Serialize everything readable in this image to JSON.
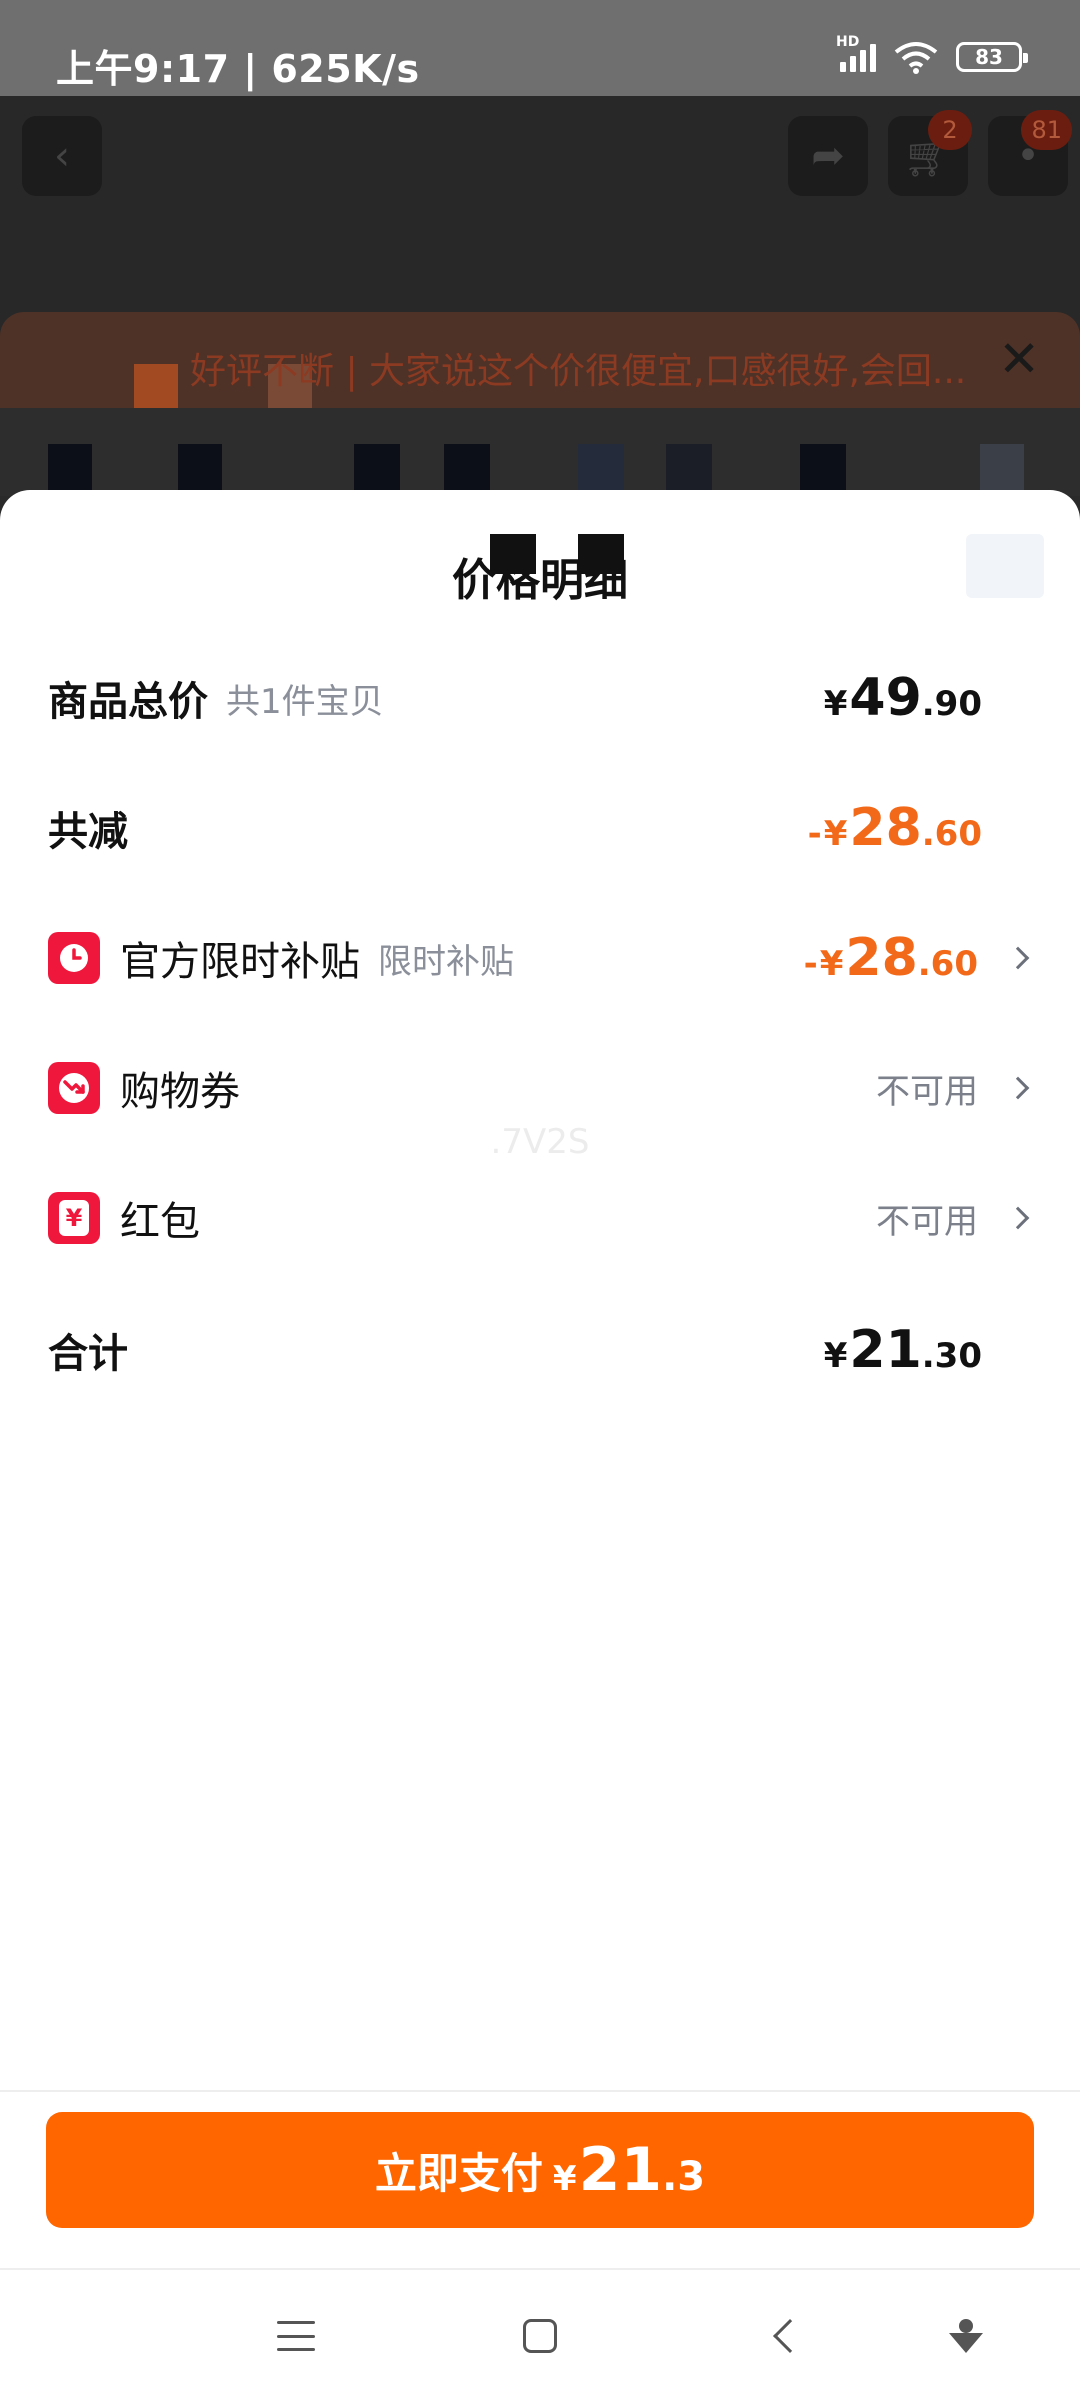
{
  "status_bar": {
    "time": "上午9:17 | 625K/s",
    "battery": "83",
    "network_label": "HD"
  },
  "background_page": {
    "cart_badge": "2",
    "more_badge": "81",
    "notice_text": "好评不断 | 大家说这个价很便宜,口感很好,会回..."
  },
  "sheet": {
    "title": "价格明细",
    "watermark": ".7V2S",
    "rows": {
      "total_goods": {
        "label": "商品总价",
        "sub": "共1件宝贝",
        "currency": "¥",
        "integer": "49",
        "decimal": ".90"
      },
      "total_discount": {
        "label": "共减",
        "prefix": "-",
        "currency": "¥",
        "integer": "28",
        "decimal": ".60"
      },
      "official_subsidy": {
        "label": "官方限时补贴",
        "sub": "限时补贴",
        "prefix": "-",
        "currency": "¥",
        "integer": "28",
        "decimal": ".60",
        "icon": "clock-icon"
      },
      "coupon": {
        "label": "购物券",
        "status": "不可用",
        "icon": "coupon-arrow-icon"
      },
      "red_packet": {
        "label": "红包",
        "status": "不可用",
        "icon": "yen-icon",
        "icon_glyph": "¥"
      },
      "subtotal": {
        "label": "合计",
        "currency": "¥",
        "integer": "21",
        "decimal": ".30"
      }
    }
  },
  "pay_button": {
    "label": "立即支付",
    "currency": "¥",
    "integer": "21",
    "decimal": ".3"
  },
  "colors": {
    "accent_orange": "#ff6600",
    "discount_orange": "#f2691a",
    "icon_red": "#f0173c"
  },
  "nav_bar": {
    "icons": [
      "menu-icon",
      "home-icon",
      "back-icon",
      "assistant-icon"
    ]
  }
}
